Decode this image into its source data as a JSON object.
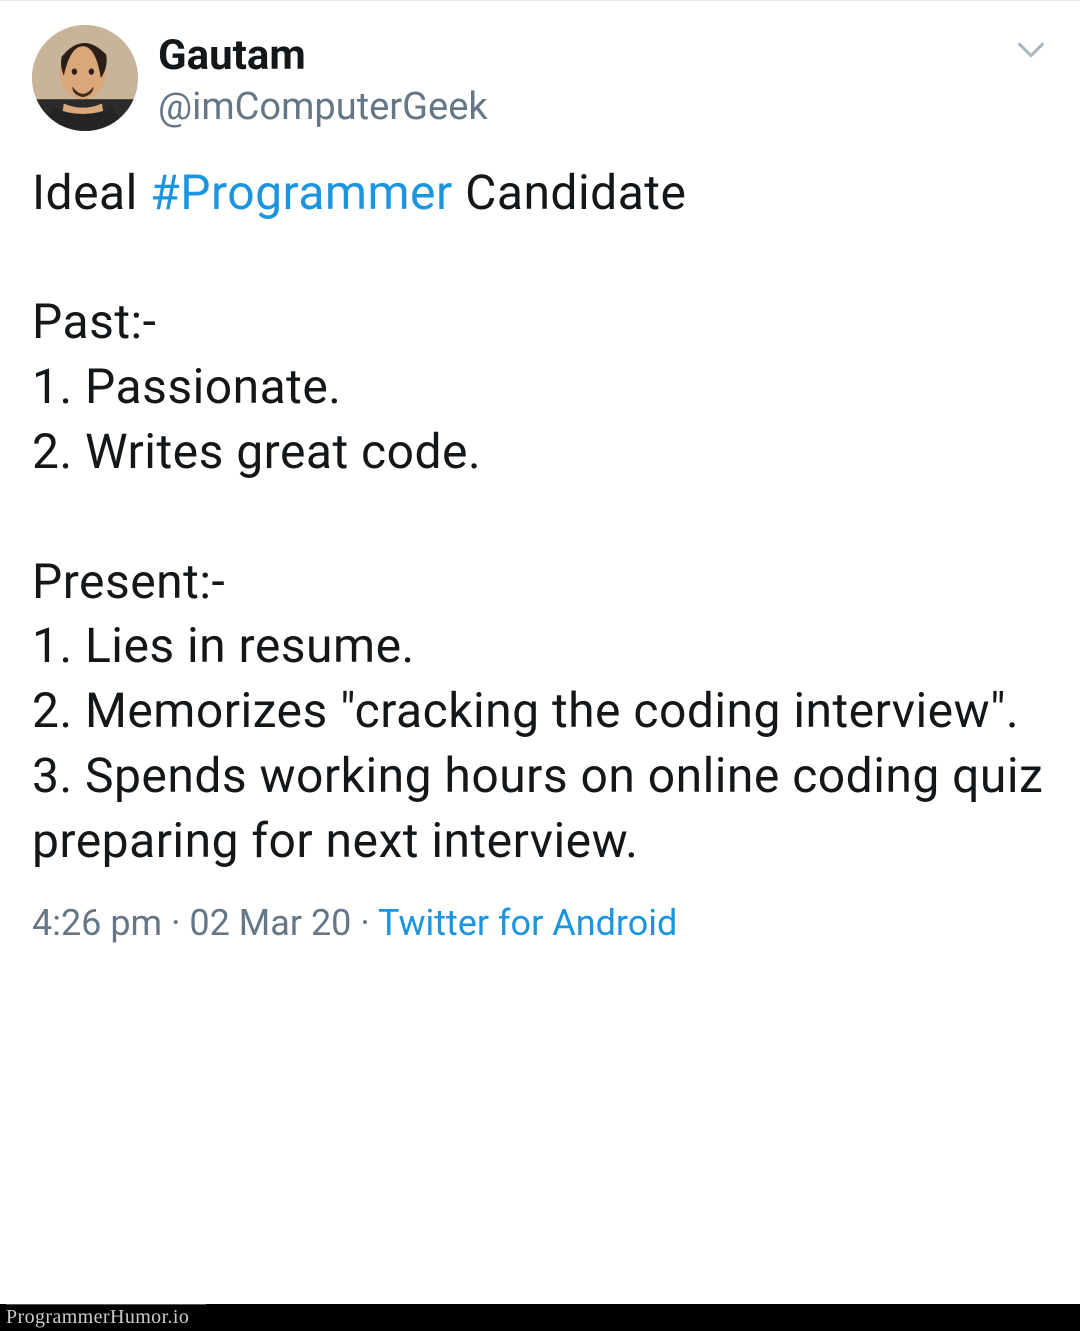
{
  "author": {
    "display_name": "Gautam",
    "username": "@imComputerGeek"
  },
  "body": {
    "head_prefix": "Ideal ",
    "hashtag": "#Programmer",
    "head_suffix": " Candidate",
    "section_past_title": "Past:-",
    "past_1": "1. Passionate.",
    "past_2": "2. Writes great code.",
    "section_present_title": "Present:-",
    "present_1": "1. Lies in resume.",
    "present_2": "2. Memorizes \"cracking the coding interview\".",
    "present_3": "3. Spends working hours on online coding quiz preparing for next interview."
  },
  "meta": {
    "time": "4:26 pm",
    "date": "02 Mar 20",
    "source": "Twitter for Android",
    "separator": " · "
  },
  "watermark": "ProgrammerHumor.io"
}
